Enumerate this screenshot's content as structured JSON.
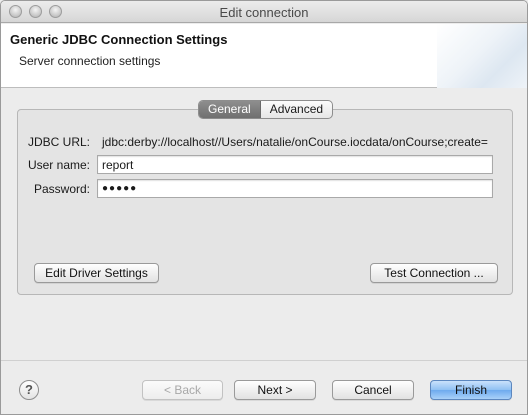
{
  "window": {
    "title": "Edit connection"
  },
  "header": {
    "title": "Generic JDBC Connection Settings",
    "subtitle": "Server connection settings"
  },
  "tabs": [
    {
      "label": "General",
      "active": true
    },
    {
      "label": "Advanced",
      "active": false
    }
  ],
  "form": {
    "jdbc_url_label": "JDBC URL:",
    "jdbc_url_value": "jdbc:derby://localhost//Users/natalie/onCourse.iocdata/onCourse;create=",
    "user_label": "User name:",
    "user_value": "report",
    "password_label": "Password:",
    "password_value": "●●●●●"
  },
  "buttons": {
    "edit_driver": "Edit Driver Settings",
    "test_connection": "Test Connection ...",
    "back": "< Back",
    "next": "Next >",
    "cancel": "Cancel",
    "finish": "Finish"
  },
  "help": {
    "glyph": "?"
  }
}
